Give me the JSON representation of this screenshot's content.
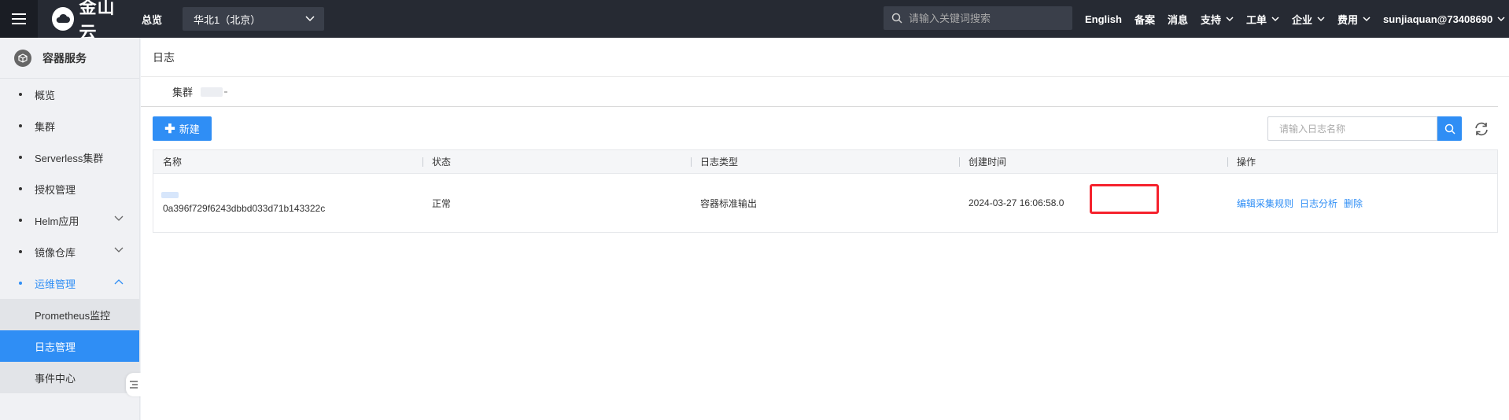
{
  "topbar": {
    "logo_text": "金山云",
    "overview": "总览",
    "region": "华北1（北京）",
    "search_placeholder": "请输入关键词搜索",
    "links": [
      {
        "label": "English",
        "dropdown": false
      },
      {
        "label": "备案",
        "dropdown": false
      },
      {
        "label": "消息",
        "dropdown": false
      },
      {
        "label": "支持",
        "dropdown": true
      },
      {
        "label": "工单",
        "dropdown": true
      },
      {
        "label": "企业",
        "dropdown": true
      },
      {
        "label": "费用",
        "dropdown": true
      },
      {
        "label": "sunjiaquan@73408690",
        "dropdown": true
      }
    ]
  },
  "sidebar": {
    "title": "容器服务",
    "items": [
      {
        "label": "概览"
      },
      {
        "label": "集群"
      },
      {
        "label": "Serverless集群"
      },
      {
        "label": "授权管理"
      },
      {
        "label": "Helm应用"
      },
      {
        "label": "镜像仓库"
      },
      {
        "label": "运维管理"
      }
    ],
    "sub_items": [
      {
        "label": "Prometheus监控"
      },
      {
        "label": "日志管理"
      },
      {
        "label": "事件中心"
      }
    ]
  },
  "main": {
    "page_title": "日志",
    "cluster_label": "集群",
    "new_button": "新建",
    "log_search_placeholder": "请输入日志名称",
    "table": {
      "headers": [
        "名称",
        "状态",
        "日志类型",
        "创建时间",
        "操作"
      ],
      "rows": [
        {
          "name_id": "0a396f729f6243dbbd033d71b143322c",
          "status": "正常",
          "log_type": "容器标准输出",
          "created": "2024-03-27 16:06:58.0",
          "actions": [
            "编辑采集规则",
            "日志分析",
            "删除"
          ]
        }
      ]
    }
  },
  "colors": {
    "topbar_bg": "#262a33",
    "accent": "#2f8ef5",
    "highlight": "#f5222d"
  }
}
